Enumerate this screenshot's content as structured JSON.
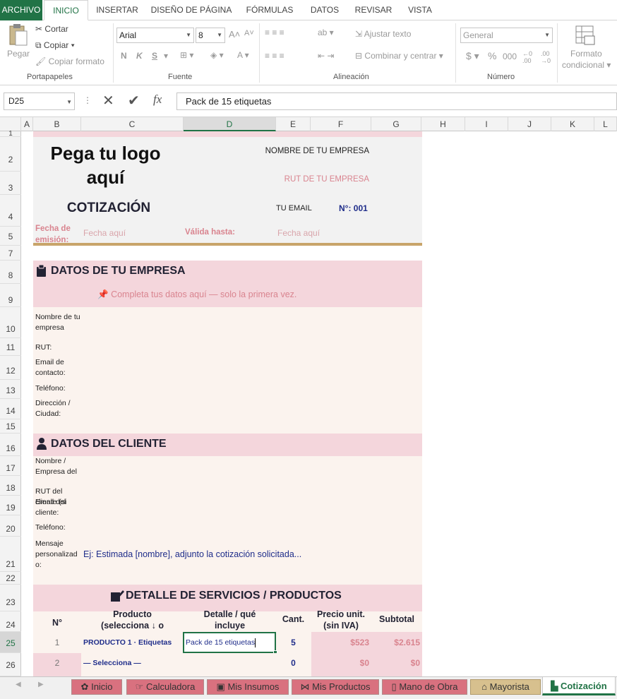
{
  "ribbon_tabs": [
    "ARCHIVO",
    "INICIO",
    "INSERTAR",
    "DISEÑO DE PÁGINA",
    "FÓRMULAS",
    "DATOS",
    "REVISAR",
    "VISTA"
  ],
  "clipboard": {
    "paste": "Pegar",
    "cut": "Cortar",
    "copy": "Copiar",
    "copy_format": "Copiar formato",
    "group": "Portapapeles"
  },
  "font": {
    "family": "Arial",
    "size": "8",
    "group": "Fuente",
    "bold": "N",
    "italic": "K",
    "underline": "S"
  },
  "alignment": {
    "wrap": "Ajustar texto",
    "merge": "Combinar y centrar",
    "group": "Alineación"
  },
  "number": {
    "format": "General",
    "currency": "$",
    "percent": "%",
    "thousands": "000",
    "group": "Número"
  },
  "styles": {
    "cond_format_1": "Formato",
    "cond_format_2": "condicional"
  },
  "formula_bar": {
    "name_box": "D25",
    "fx": "fx",
    "content": "Pack de 15 etiquetas"
  },
  "columns": [
    "A",
    "B",
    "C",
    "D",
    "E",
    "F",
    "G",
    "H",
    "I",
    "J",
    "K",
    "L"
  ],
  "rows": [
    "1",
    "2",
    "3",
    "4",
    "5",
    "7",
    "8",
    "9",
    "10",
    "11",
    "12",
    "13",
    "14",
    "15",
    "16",
    "17",
    "18",
    "19",
    "20",
    "21",
    "22",
    "23",
    "24",
    "25",
    "26"
  ],
  "header": {
    "logo_1": "Pega tu logo",
    "logo_2": "aquí",
    "title": "COTIZACIÓN",
    "company": "NOMBRE DE TU EMPRESA",
    "rut": "RUT DE TU EMPRESA",
    "email": "TU EMAIL",
    "number": "N°: 001",
    "issue_label_1": "Fecha de",
    "issue_label_2": "emisión:",
    "issue_value": "Fecha aquí",
    "valid_label": "Válida hasta:",
    "valid_value": "Fecha aquí"
  },
  "company_section": {
    "title": "DATOS DE TU EMPRESA",
    "hint": "Completa tus datos aquí — solo la primera vez.",
    "fields": [
      "Nombre de tu empresa",
      "RUT:",
      "Email de contacto:",
      "Teléfono:",
      "Dirección / Ciudad:"
    ]
  },
  "client_section": {
    "title": "DATOS DEL CLIENTE",
    "fields": [
      "Nombre / Empresa del",
      "RUT del cliente (si",
      "Email del cliente:",
      "Teléfono:",
      "Mensaje personalizad o:"
    ],
    "message": "Ej: Estimada [nombre], adjunto la cotización solicitada..."
  },
  "products_section": {
    "title": "DETALLE DE SERVICIOS / PRODUCTOS",
    "headers": [
      "N°",
      "Producto (selecciona ↓ o escribe)",
      "Detalle / qué incluye",
      "Cant.",
      "Precio unit. (sin IVA)",
      "Subtotal"
    ],
    "rows": [
      {
        "n": "1",
        "product": "PRODUCTO 1 · Etiquetas",
        "detail": "Pack de 15 etiquetas",
        "qty": "5",
        "price": "$523",
        "subtotal": "$2.615"
      },
      {
        "n": "2",
        "product": "— Selecciona —",
        "detail": "",
        "qty": "0",
        "price": "$0",
        "subtotal": "$0"
      }
    ]
  },
  "sheet_tabs": [
    "Inicio",
    "Calculadora",
    "Mis Insumos",
    "Mis Productos",
    "Mano de Obra",
    "Mayorista",
    "Cotización"
  ],
  "colors": {
    "excel_green": "#217346",
    "pink": "#f4d6dc",
    "cream": "#fbf3ee",
    "navy": "#1f2d8a",
    "rose_text": "#d9848f",
    "gold_rule": "#c8a46a"
  }
}
